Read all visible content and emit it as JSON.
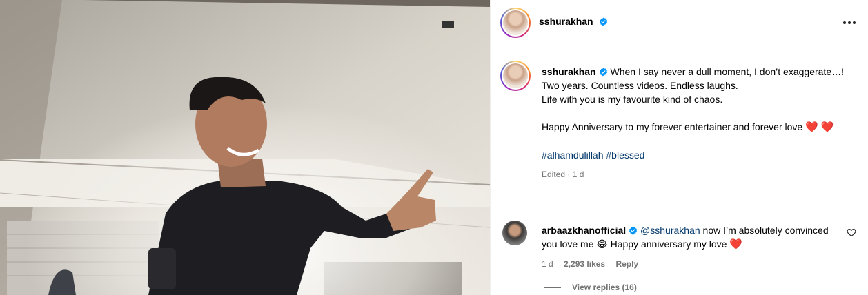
{
  "media": {
    "alt_icon": "photo"
  },
  "post": {
    "author": "sshurakhan",
    "more_icon": "more-horizontal-icon"
  },
  "caption": {
    "author": "sshurakhan",
    "lines": [
      "When I say never a dull moment, I don’t exaggerate…!",
      "Two years. Countless videos. Endless laughs.",
      "Life with you is my favourite kind of chaos."
    ],
    "anniversary": "Happy Anniversary to my forever entertainer and forever love",
    "heart_emoji": "❤️",
    "hashtags": "#alhamdulillah #blessed",
    "meta": "Edited · 1 d"
  },
  "comment": {
    "author": "arbaazkhanofficial",
    "mention": "@sshurakhan",
    "text_1": " now I’m absolutely convinced you love me ",
    "laugh_emoji": "😂",
    "text_2": " Happy anniversary my love ",
    "heart_emoji": "❤️",
    "time": "1 d",
    "likes": "2,293 likes",
    "reply": "Reply"
  },
  "view_replies": "View replies (16)",
  "colors": {
    "verified": "#0095f6",
    "link": "#00376b",
    "secondary": "#737373",
    "heart": "#e41e3f"
  }
}
